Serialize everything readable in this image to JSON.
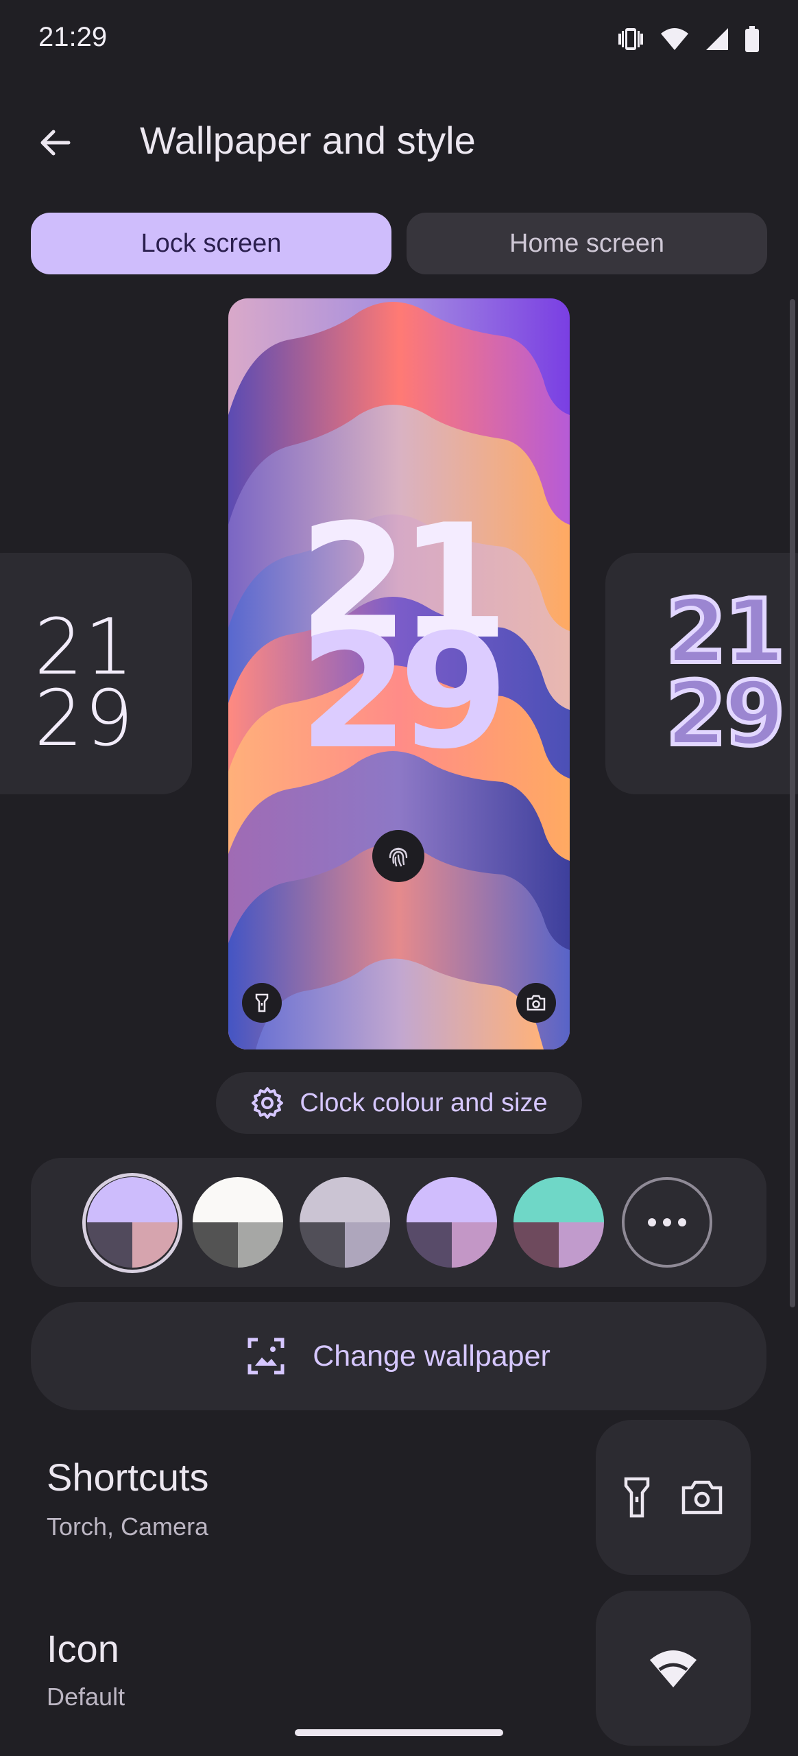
{
  "status_bar": {
    "time": "21:29"
  },
  "header": {
    "title": "Wallpaper and style"
  },
  "tabs": [
    {
      "label": "Lock screen",
      "selected": true
    },
    {
      "label": "Home screen",
      "selected": false
    }
  ],
  "clock_styles": {
    "left": {
      "hours": "21",
      "minutes": "29"
    },
    "right": {
      "hours": "21",
      "minutes": "29"
    }
  },
  "preview": {
    "hours": "21",
    "minutes": "29"
  },
  "clock_button": {
    "label": "Clock colour and size"
  },
  "color_options": [
    {
      "top": "#cdbcfc",
      "bl": "#514a5c",
      "br": "#d6a4ae",
      "selected": true
    },
    {
      "top": "#faf9f7",
      "bl": "#535353",
      "br": "#a6a7a5",
      "selected": false
    },
    {
      "top": "#cbc4d3",
      "bl": "#514f58",
      "br": "#aea6bc",
      "selected": false
    },
    {
      "top": "#d0bdfd",
      "bl": "#584b69",
      "br": "#c397c6",
      "selected": false
    },
    {
      "top": "#6fd7c7",
      "bl": "#6e4a5d",
      "br": "#c19bcc",
      "selected": false
    }
  ],
  "change_wallpaper": {
    "label": "Change wallpaper"
  },
  "shortcuts": {
    "title": "Shortcuts",
    "subtitle": "Torch, Camera"
  },
  "icon": {
    "title": "Icon",
    "subtitle": "Default"
  }
}
